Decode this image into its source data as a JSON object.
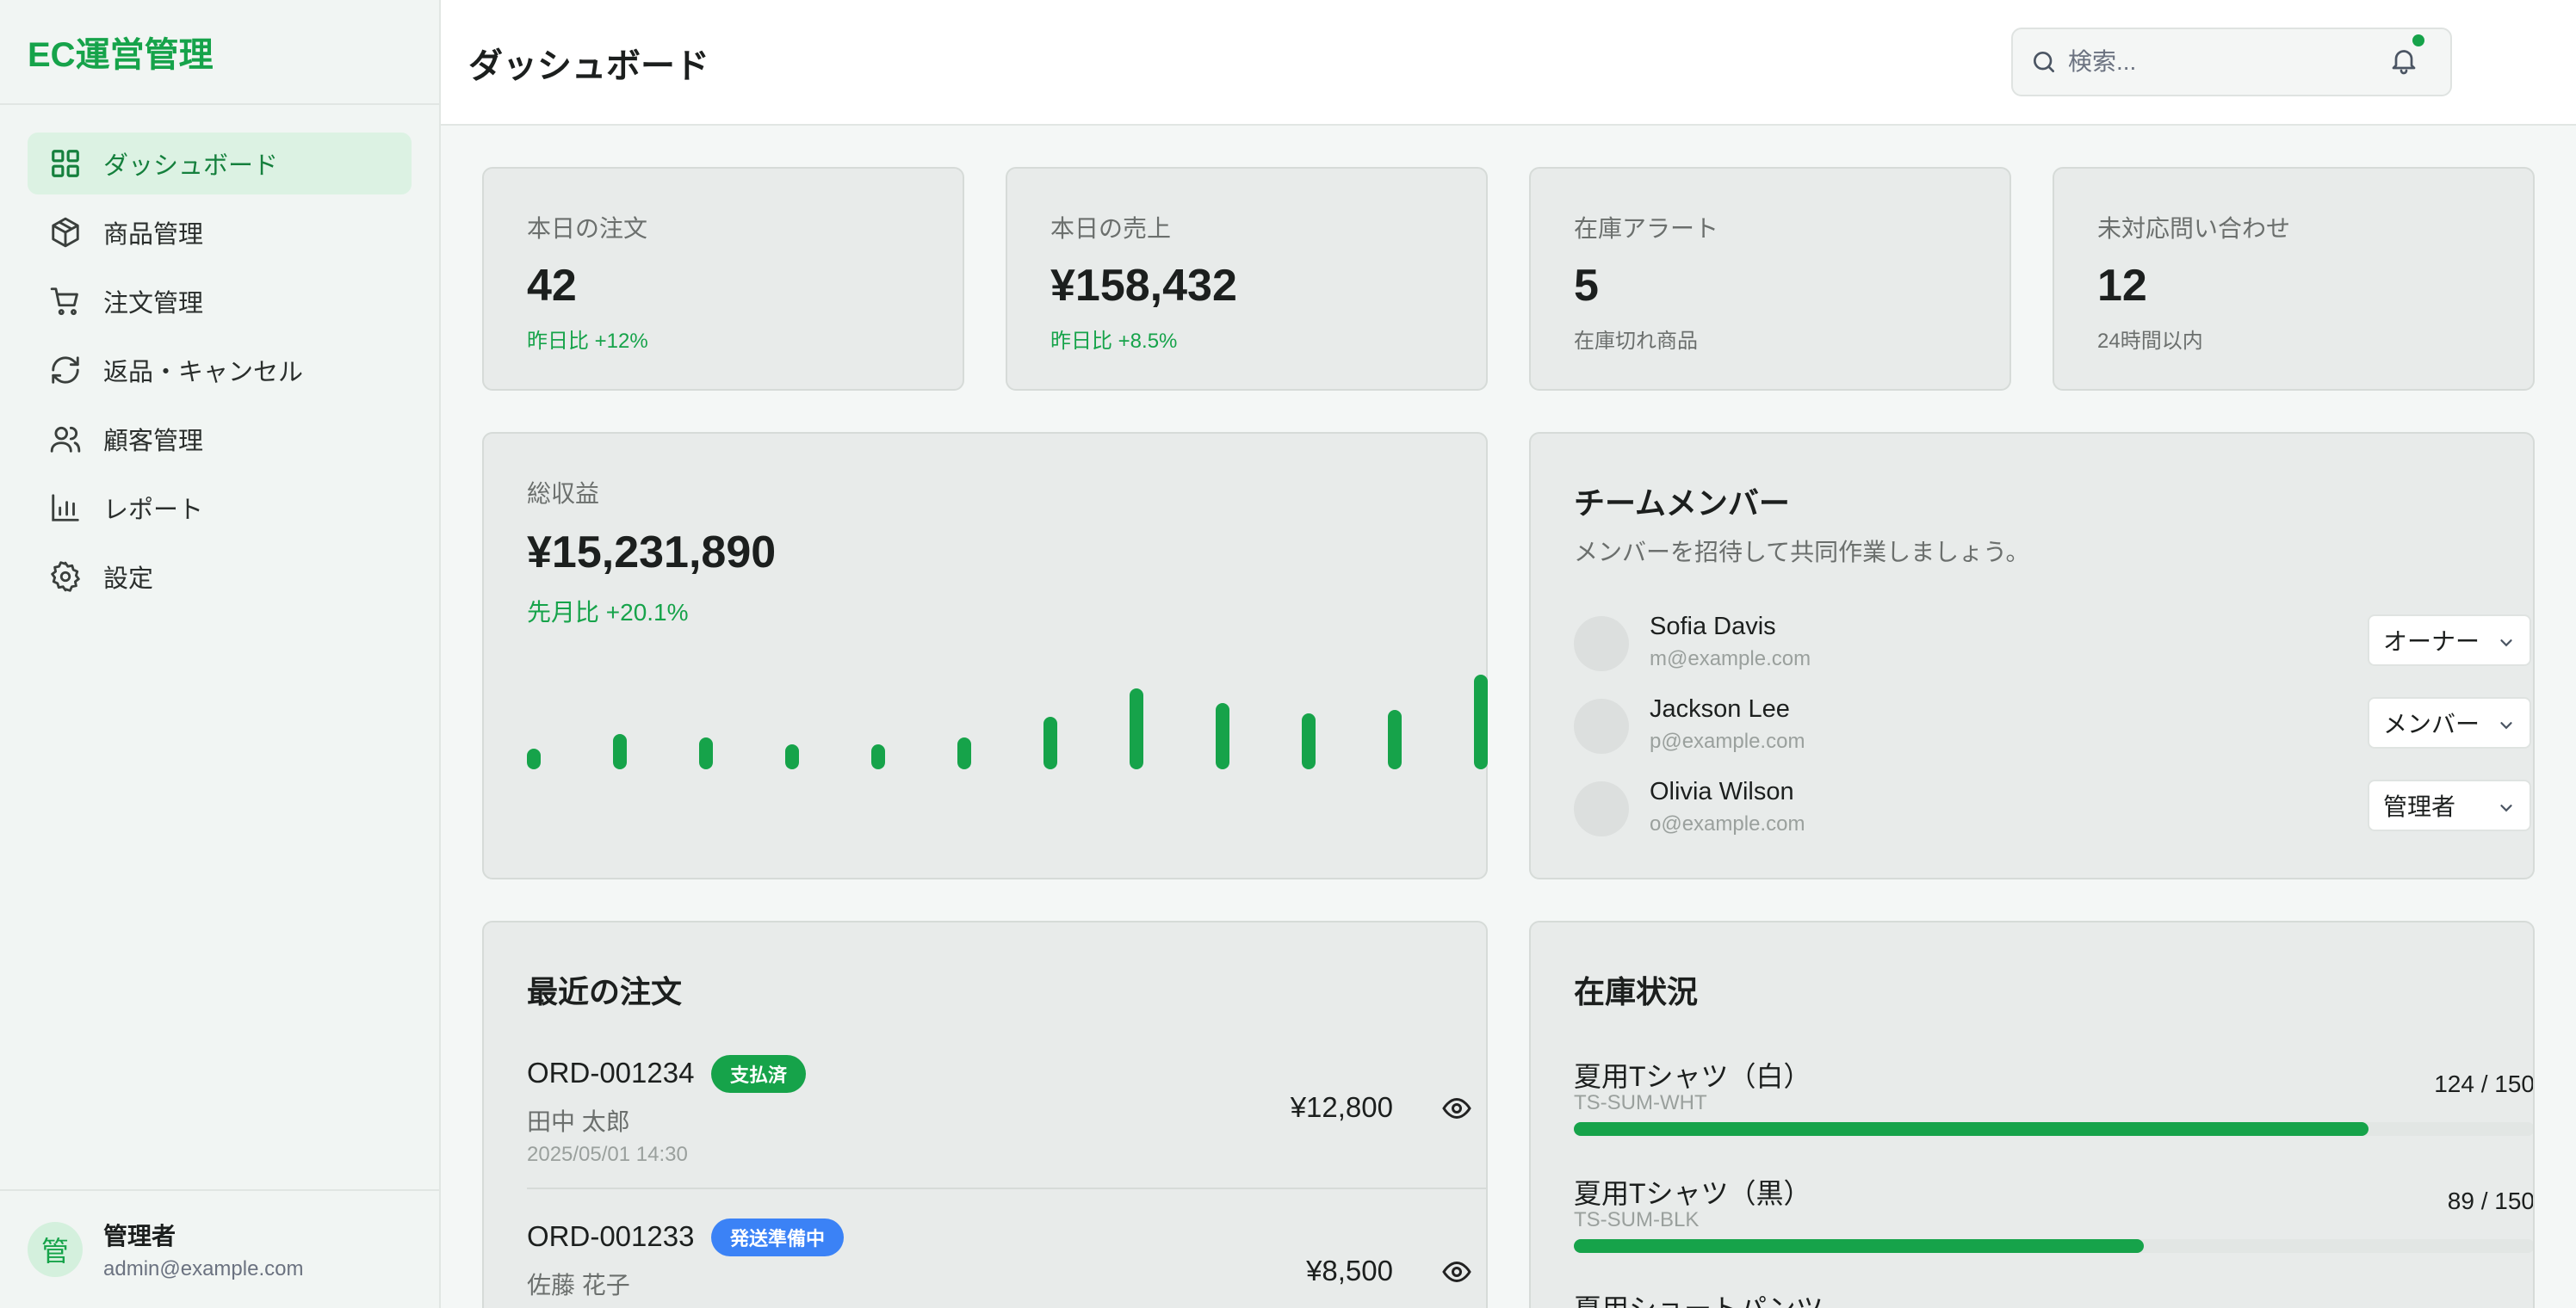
{
  "brand": "EC運営管理",
  "nav": [
    {
      "label": "ダッシュボード",
      "icon": "grid-icon",
      "active": true
    },
    {
      "label": "商品管理",
      "icon": "box-icon"
    },
    {
      "label": "注文管理",
      "icon": "cart-icon"
    },
    {
      "label": "返品・キャンセル",
      "icon": "refresh-icon"
    },
    {
      "label": "顧客管理",
      "icon": "users-icon"
    },
    {
      "label": "レポート",
      "icon": "bar-chart-icon"
    },
    {
      "label": "設定",
      "icon": "gear-icon"
    }
  ],
  "admin": {
    "avatar": "管",
    "name": "管理者",
    "email": "admin@example.com"
  },
  "header": {
    "title": "ダッシュボード",
    "search_placeholder": "検索..."
  },
  "stats": [
    {
      "label": "本日の注文",
      "value": "42",
      "sub": "昨日比 +12%"
    },
    {
      "label": "本日の売上",
      "value": "¥158,432",
      "sub": "昨日比 +8.5%"
    },
    {
      "label": "在庫アラート",
      "value": "5",
      "sub": "在庫切れ商品"
    },
    {
      "label": "未対応問い合わせ",
      "value": "12",
      "sub": "24時間以内"
    }
  ],
  "revenue": {
    "label": "総収益",
    "value": "¥15,231,890",
    "sub": "先月比 +20.1%"
  },
  "chart_data": {
    "type": "bar",
    "values": [
      3,
      5,
      4.5,
      3.5,
      3.5,
      4.5,
      7.5,
      11.5,
      9.5,
      8,
      8.5,
      13.5
    ],
    "color": "#16a34a"
  },
  "team": {
    "title": "チームメンバー",
    "desc": "メンバーを招待して共同作業しましょう。",
    "members": [
      {
        "name": "Sofia Davis",
        "email": "m@example.com",
        "role": "オーナー"
      },
      {
        "name": "Jackson Lee",
        "email": "p@example.com",
        "role": "メンバー"
      },
      {
        "name": "Olivia Wilson",
        "email": "o@example.com",
        "role": "管理者"
      }
    ]
  },
  "orders": {
    "title": "最近の注文",
    "items": [
      {
        "id": "ORD-001234",
        "status": "支払済",
        "customer": "田中 太郎",
        "date": "2025/05/01 14:30",
        "amount": "¥12,800"
      },
      {
        "id": "ORD-001233",
        "status": "発送準備中",
        "customer": "佐藤 花子",
        "amount": "¥8,500"
      }
    ]
  },
  "inventory": {
    "title": "在庫状況",
    "items": [
      {
        "name": "夏用Tシャツ（白）",
        "sku": "TS-SUM-WHT",
        "count": "124 / 150",
        "ratio": 0.827
      },
      {
        "name": "夏用Tシャツ（黒）",
        "sku": "TS-SUM-BLK",
        "count": "89 / 150",
        "ratio": 0.593
      },
      {
        "name": "夏用ショートパンツ"
      }
    ]
  },
  "colors": {
    "accent": "#16a34a",
    "badge_blue": "#3b82f6"
  }
}
